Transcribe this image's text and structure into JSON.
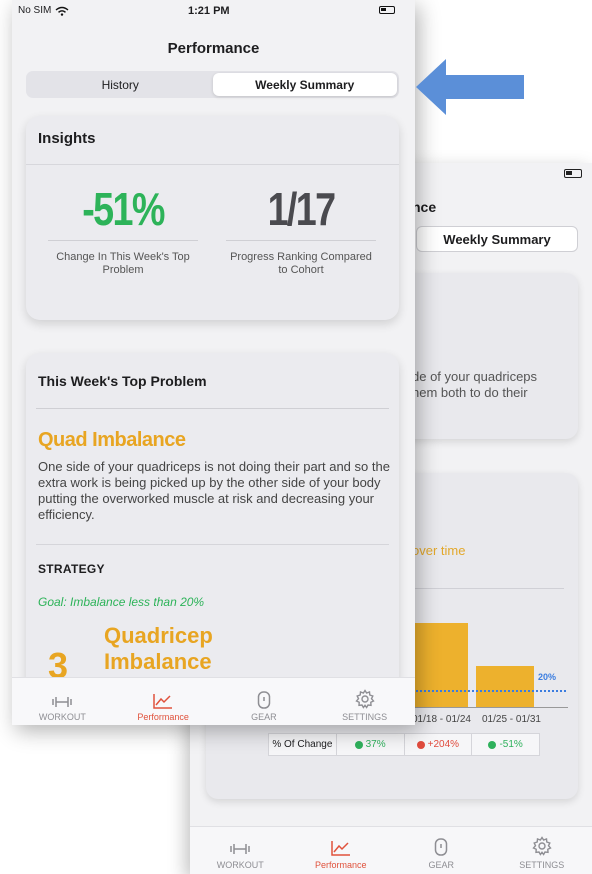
{
  "front": {
    "status": {
      "carrier": "No SIM",
      "time": "1:21 PM"
    },
    "title": "Performance",
    "tabs": [
      {
        "label": "History",
        "active": false
      },
      {
        "label": "Weekly Summary",
        "active": true
      }
    ],
    "insights": {
      "title": "Insights",
      "metric1": {
        "value": "-51%",
        "caption": "Change In This Week's Top Problem"
      },
      "metric2": {
        "value": "1/17",
        "caption": "Progress Ranking Compared to Cohort"
      }
    },
    "problem": {
      "title": "This Week's Top Problem",
      "name": "Quad Imbalance",
      "description": "One side of your quadriceps is not doing their part and so the extra work is being picked up by the other side of your body putting the overworked muscle at risk and decreasing your efficiency.",
      "strategy_label": "STRATEGY",
      "goal": "Goal: Imbalance less than 20%",
      "step_number": "3",
      "step_label": "Quadricep Imbalance"
    },
    "tabbar": [
      {
        "label": "WORKOUT",
        "icon": "dumbbell-icon",
        "active": false
      },
      {
        "label": "Performance",
        "icon": "chart-icon",
        "active": true
      },
      {
        "label": "GEAR",
        "icon": "gear-device-icon",
        "active": false
      },
      {
        "label": "SETTINGS",
        "icon": "settings-gear-icon",
        "active": false
      }
    ]
  },
  "back": {
    "title_fragment": "nce",
    "tab_label": "Weekly Summary",
    "card_text": "de of your quadriceps\nhem both to do their",
    "over_time": "over time",
    "goal_value": "20%",
    "categories": [
      "01/18 - 01/24",
      "01/25 - 01/31"
    ],
    "change_label": "% Of Change",
    "changes": [
      {
        "text": "37%",
        "direction": "down"
      },
      {
        "text": "+204%",
        "direction": "up"
      },
      {
        "text": "-51%",
        "direction": "down"
      }
    ],
    "tabbar": [
      {
        "label": "WORKOUT",
        "active": false
      },
      {
        "label": "Performance",
        "active": true
      },
      {
        "label": "GEAR",
        "active": false
      },
      {
        "label": "SETTINGS",
        "active": false
      }
    ]
  },
  "colors": {
    "accent_orange": "#e8a522",
    "accent_green": "#2db359",
    "active_tab": "#e0523c",
    "arrow_blue": "#5b8fd8"
  }
}
